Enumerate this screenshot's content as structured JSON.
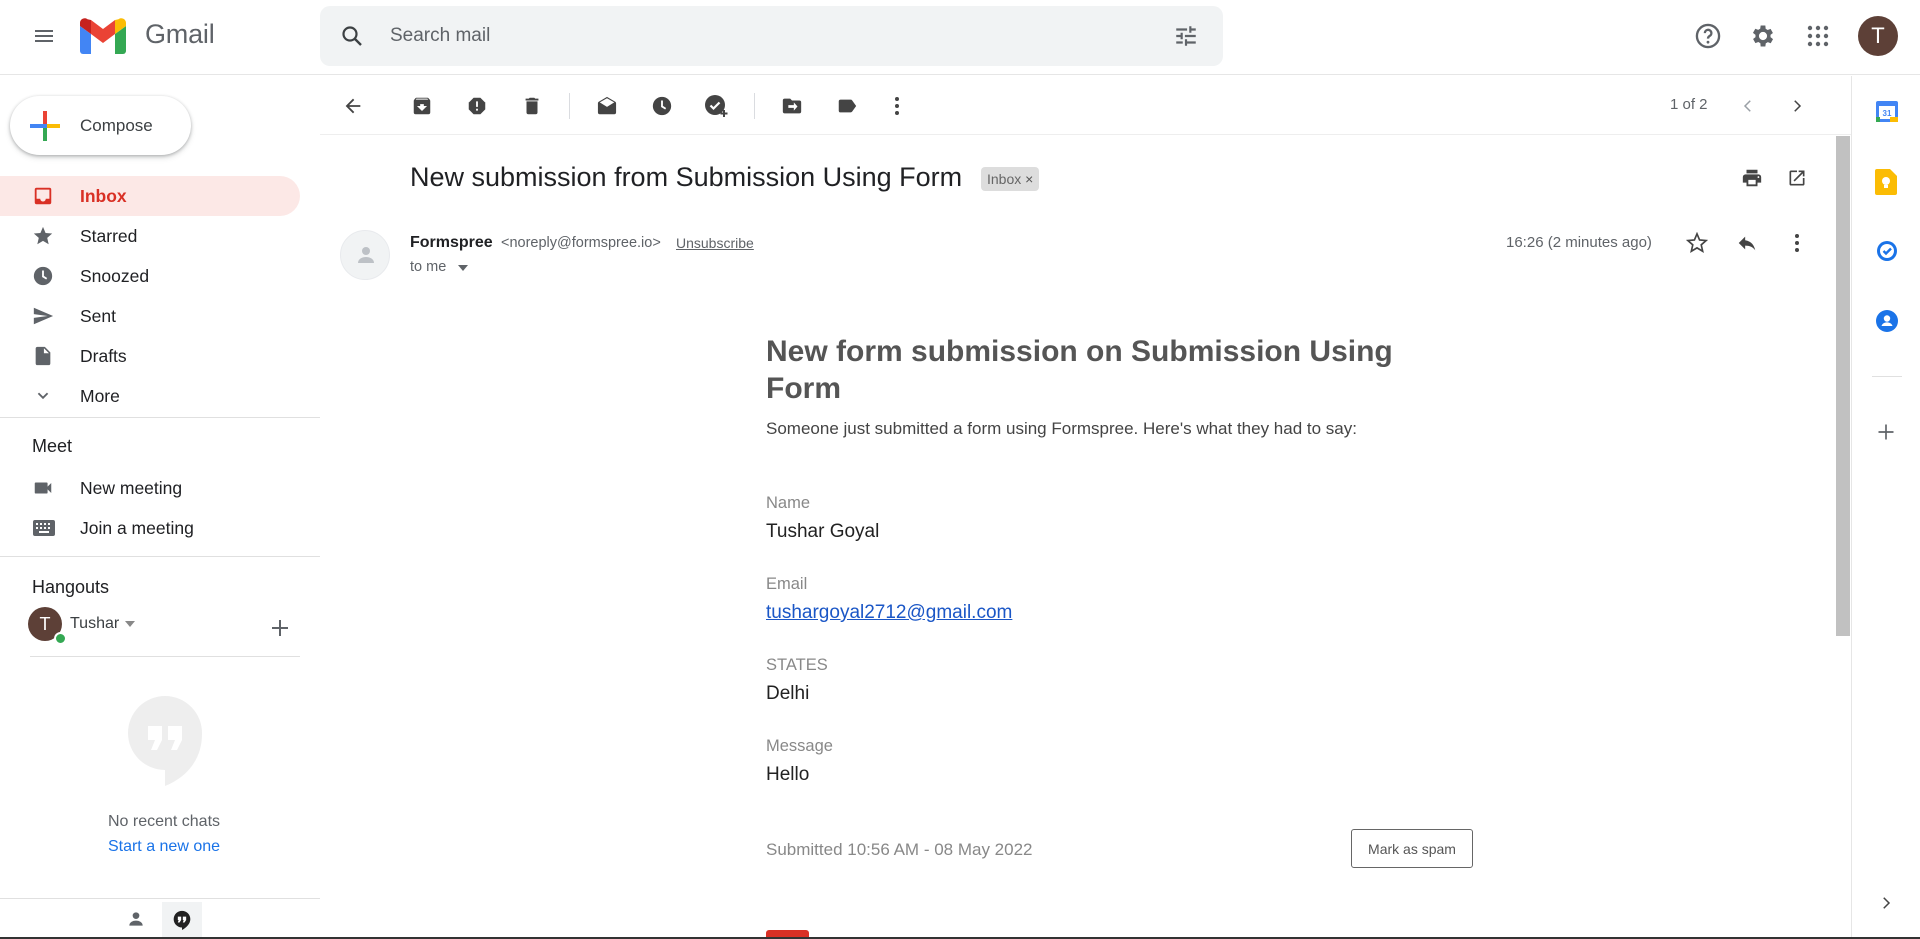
{
  "app": {
    "name": "Gmail"
  },
  "search": {
    "placeholder": "Search mail"
  },
  "account": {
    "initial": "T"
  },
  "compose": {
    "label": "Compose"
  },
  "nav": {
    "items": [
      {
        "label": "Inbox"
      },
      {
        "label": "Starred"
      },
      {
        "label": "Snoozed"
      },
      {
        "label": "Sent"
      },
      {
        "label": "Drafts"
      },
      {
        "label": "More"
      }
    ]
  },
  "meet": {
    "title": "Meet",
    "new_meeting": "New meeting",
    "join_meeting": "Join a meeting"
  },
  "hangouts": {
    "title": "Hangouts",
    "user": "Tushar",
    "user_initial": "T",
    "no_chats": "No recent chats",
    "start_new": "Start a new one"
  },
  "toolbar": {
    "pager": "1 of 2"
  },
  "message": {
    "subject": "New submission from Submission Using Form",
    "label_chip": "Inbox",
    "sender_name": "Formspree",
    "sender_email": "<noreply@formspree.io>",
    "unsubscribe": "Unsubscribe",
    "to": "to me",
    "time": "16:26 (2 minutes ago)"
  },
  "email_body": {
    "title": "New form submission on Submission Using Form",
    "intro": "Someone just submitted a form using Formspree. Here's what they had to say:",
    "fields": [
      {
        "label": "Name",
        "value": "Tushar Goyal"
      },
      {
        "label": "Email",
        "value": "tushargoyal2712@gmail.com"
      },
      {
        "label": "STATES",
        "value": "Delhi"
      },
      {
        "label": "Message",
        "value": "Hello"
      }
    ],
    "submitted": "Submitted 10:56 AM - 08 May 2022",
    "spam_button": "Mark as spam"
  },
  "colors": {
    "accent_red": "#d93025",
    "link_blue": "#1a56c6",
    "active_bg": "#fce8e6"
  }
}
